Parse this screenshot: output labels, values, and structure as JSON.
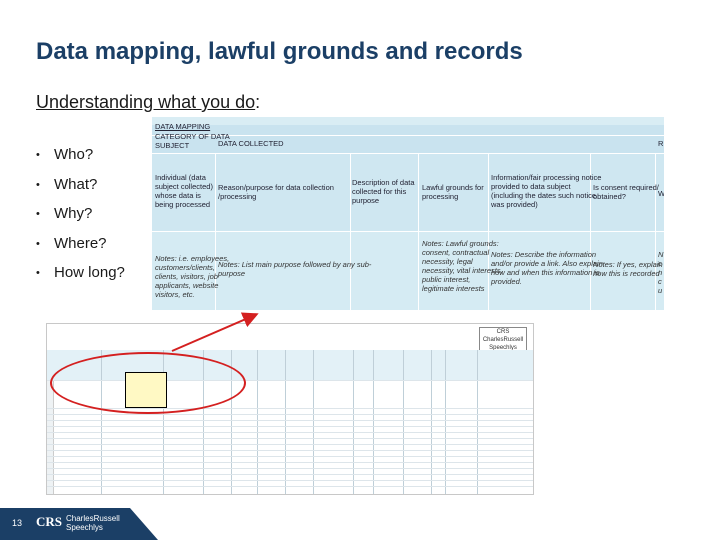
{
  "slide": {
    "title": "Data mapping, lawful grounds and records",
    "subtitle_underlined": "Understanding what you do",
    "subtitle_suffix": ":",
    "bullets": [
      "Who?",
      "What?",
      "Why?",
      "Where?",
      "How long?"
    ],
    "page_number": "13"
  },
  "spreadsheet_zoom": {
    "title": "DATA MAPPING",
    "category_header": "CATEGORY OF DATA\nSUBJECT",
    "data_collected": "DATA COLLECTED",
    "right_cut_header": "R",
    "columns": [
      "Individual (data\nsubject collected)\nwhose data is\nbeing processed",
      "Reason/purpose for data collection\n/processing",
      "Description of data\ncollected for this\npurpose",
      "Lawful grounds for\nprocessing",
      "Information/fair processing notice\nprovided to data subject\n(including the dates such notice\nwas provided)",
      "Is consent required/\nobtained?",
      "W"
    ],
    "notes": [
      "Notes: i.e. employees,\ncustomers/clients,\nclients, visitors, job\napplicants, website\nvisitors, etc.",
      "Notes: List main purpose followed by any sub-\npurpose",
      "",
      "Notes: Lawful grounds:\nconsent, contractual\nnecessity, legal\nnecessity, vital interests,\npublic interest,\nlegitimate interests",
      "Notes: Describe the information\nand/or provide a link. Also explain\nhow and when this information is\nprovided.",
      "Notes: If yes, explain\nhow this is recorded",
      "N\nc\nn\nc\nu"
    ]
  },
  "thumbnail": {
    "logo_text": "CRS\nCharlesRussell\nSpeechlys"
  },
  "footer": {
    "brand_short": "CRS",
    "brand_name": "CharlesRussell\nSpeechlys"
  },
  "colors": {
    "title": "#1b3f66",
    "sheet_bg": "#c9e3ef",
    "highlight_oval": "#d42020",
    "footer_bg": "#1b3f66"
  }
}
